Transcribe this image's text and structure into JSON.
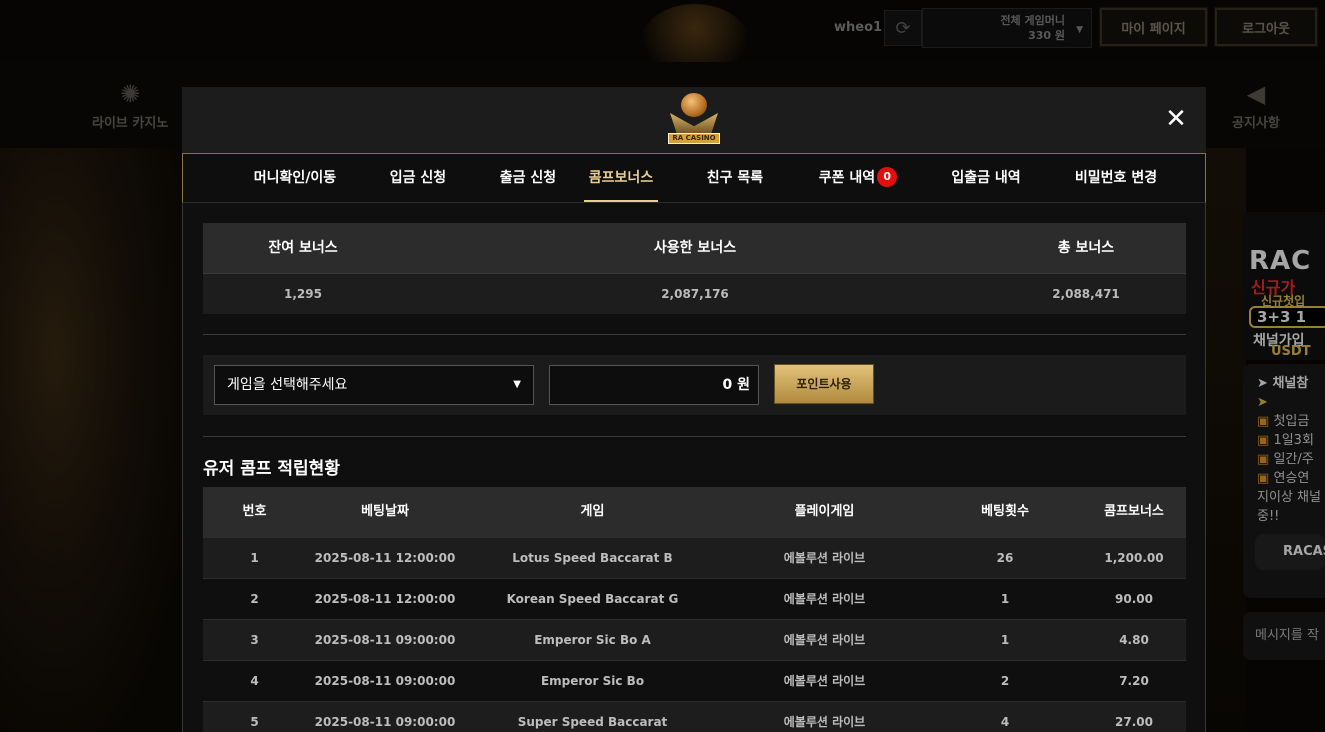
{
  "header": {
    "username": "wheo1",
    "money_label": "전체 게임머니",
    "money_value": "330 원",
    "mypage_label": "마이 페이지",
    "logout_label": "로그아웃"
  },
  "nav": {
    "left_item": "라이브 카지노",
    "right_item": "공지사항"
  },
  "sidebar": {
    "banner_line1": "RAC",
    "banner_line2": "신규가",
    "banner_line3": "신규첫입",
    "banner_line4": "3+3 1",
    "banner_line5": "채널가입",
    "banner_line6": "USDT",
    "panel_title": "채널참",
    "panel_lines": [
      "첫입금",
      "1일3회",
      "일간/주",
      "연승연"
    ],
    "panel_tail1": "지이상 채널",
    "panel_tail2": "중!!",
    "racas_label": "RACAS",
    "message_placeholder": "메시지를 작"
  },
  "modal": {
    "logo_text": "RA CASINO",
    "close_label": "✕",
    "tabs": [
      {
        "label": "머니확인/이동",
        "active": false
      },
      {
        "label": "입금 신청",
        "active": false
      },
      {
        "label": "출금 신청",
        "active": false
      },
      {
        "label": "콤프보너스",
        "active": true
      },
      {
        "label": "친구 목록",
        "active": false
      },
      {
        "label": "쿠폰 내역",
        "active": false,
        "badge": "0"
      },
      {
        "label": "입출금 내역",
        "active": false
      },
      {
        "label": "비밀번호 변경",
        "active": false
      }
    ],
    "summary": {
      "headers": [
        "잔여 보너스",
        "사용한 보너스",
        "총 보너스"
      ],
      "values": [
        "1,295",
        "2,087,176",
        "2,088,471"
      ]
    },
    "use_point": {
      "select_placeholder": "게임을 선택해주세요",
      "amount_value": "0 원",
      "button_label": "포인트사용"
    },
    "history_title": "유저 콤프 적립현황",
    "history": {
      "headers": [
        "번호",
        "베팅날짜",
        "게임",
        "플레이게임",
        "베팅횟수",
        "콤프보너스"
      ],
      "rows": [
        [
          "1",
          "2025-08-11 12:00:00",
          "Lotus Speed Baccarat B",
          "에볼루션 라이브",
          "26",
          "1,200.00"
        ],
        [
          "2",
          "2025-08-11 12:00:00",
          "Korean Speed Baccarat G",
          "에볼루션 라이브",
          "1",
          "90.00"
        ],
        [
          "3",
          "2025-08-11 09:00:00",
          "Emperor Sic Bo A",
          "에볼루션 라이브",
          "1",
          "4.80"
        ],
        [
          "4",
          "2025-08-11 09:00:00",
          "Emperor Sic Bo",
          "에볼루션 라이브",
          "2",
          "7.20"
        ],
        [
          "5",
          "2025-08-11 09:00:00",
          "Super Speed Baccarat",
          "에볼루션 라이브",
          "4",
          "27.00"
        ]
      ]
    }
  }
}
